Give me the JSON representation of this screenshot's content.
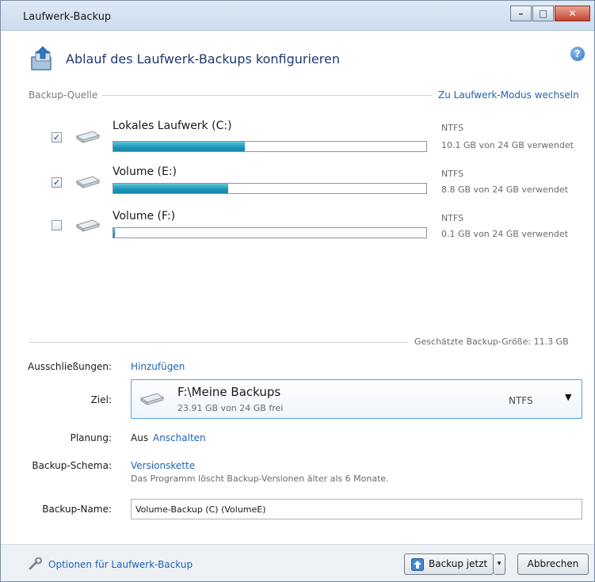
{
  "window": {
    "title": "Laufwerk-Backup",
    "controls": [
      "–",
      "□",
      "✕"
    ]
  },
  "header": {
    "title": "Ablauf des Laufwerk-Backups konfigurieren",
    "help": "?"
  },
  "source": {
    "label": "Backup-Quelle",
    "mode_link": "Zu Laufwerk-Modus wechseln",
    "drives": [
      {
        "name": "Lokales Laufwerk (C:)",
        "checked": true,
        "filesystem": "NTFS",
        "usage": "10.1 GB von 24 GB verwendet",
        "fill": 0.42
      },
      {
        "name": "Volume (E:)",
        "checked": true,
        "filesystem": "NTFS",
        "usage": "8.8 GB von 24 GB verwendet",
        "fill": 0.367
      },
      {
        "name": "Volume (F:)",
        "checked": false,
        "filesystem": "NTFS",
        "usage": "0.1 GB von 24 GB verwendet",
        "fill": 0.004
      }
    ],
    "estimated_size": "Geschätzte Backup-Größe: 11.3 GB"
  },
  "form": {
    "exclusions_label": "Ausschließungen:",
    "exclusions_link": "Hinzufügen",
    "target_label": "Ziel:",
    "target": {
      "path": "F:\\Meine Backups",
      "free": "23.91 GB von 24 GB frei",
      "filesystem": "NTFS"
    },
    "schedule_label": "Planung:",
    "schedule_value": "Aus",
    "schedule_link": "Anschalten",
    "scheme_label": "Backup-Schema:",
    "scheme_link": "Versionskette",
    "scheme_desc": "Das Programm löscht Backup-Versionen älter als 6 Monate.",
    "name_label": "Backup-Name:",
    "name_value": "Volume-Backup (C) (VolumeE)"
  },
  "footer": {
    "options_link": "Optionen für Laufwerk-Backup",
    "backup_button": "Backup jetzt",
    "split_caret": "▾",
    "cancel_button": "Abbrechen"
  }
}
